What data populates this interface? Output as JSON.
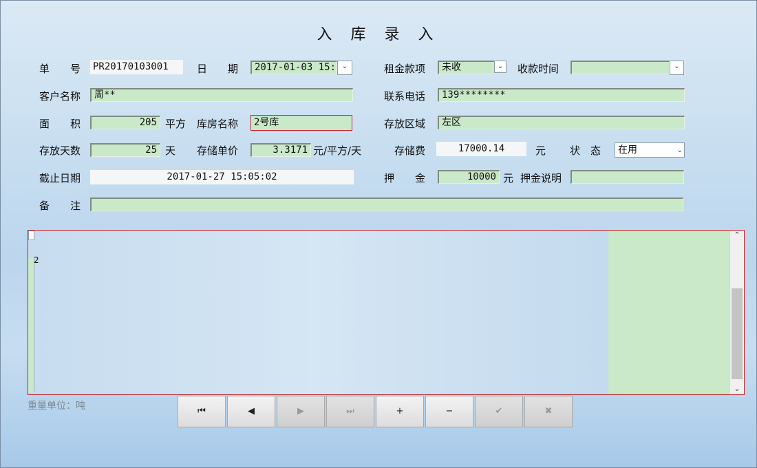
{
  "title": "入 库 录 入",
  "labels": {
    "doc_no": "单　　号",
    "date": "日　　期",
    "rent_item": "租金款项",
    "payment_time": "收款时间",
    "customer": "客户名称",
    "phone": "联系电话",
    "area": "面　　积",
    "area_unit": "平方",
    "warehouse": "库房名称",
    "zone": "存放区域",
    "days": "存放天数",
    "days_unit": "天",
    "unit_price": "存储单价",
    "price_unit": "元/平方/天",
    "fee": "存储费",
    "fee_unit": "元",
    "status": "状　态",
    "end_date": "截止日期",
    "deposit": "押　　金",
    "deposit_unit": "元",
    "deposit_note": "押金说明",
    "remark": "备　　注"
  },
  "values": {
    "doc_no": "PR20170103001",
    "date": "2017-01-03 15:",
    "rent_item": "未收",
    "payment_time": "",
    "customer": "周**",
    "phone": "139********",
    "area": "205",
    "warehouse": "2号库",
    "zone": "左区",
    "days": "25",
    "unit_price": "3.3171",
    "fee": "17000.14",
    "status": "在用",
    "end_date": "2017-01-27 15:05:02",
    "deposit": "10000",
    "deposit_note": "",
    "remark": ""
  },
  "grid": {
    "row_indicator": "2"
  },
  "unit_note": "重量单位：吨",
  "nav": {
    "first": "⏮",
    "prev": "◀",
    "next": "▶",
    "last": "⏭",
    "add": "+",
    "remove": "−",
    "confirm": "✔",
    "cancel": "✖"
  },
  "colors": {
    "field_bg": "#c9e9c9",
    "highlight_border": "#c0242b"
  }
}
